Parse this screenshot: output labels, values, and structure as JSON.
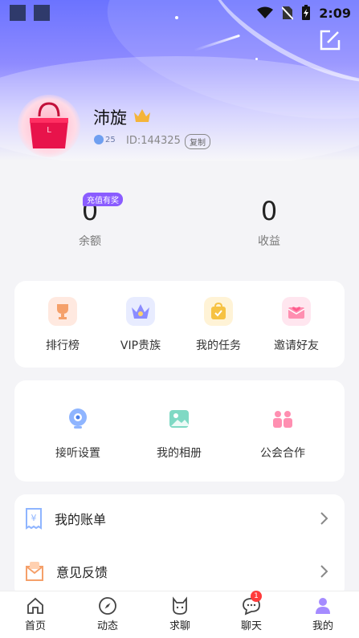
{
  "status_bar": {
    "time": "2:09"
  },
  "profile": {
    "name": "沛旋",
    "level": "25",
    "id_text": "ID:144325",
    "copy_label": "复制"
  },
  "stats": {
    "balance": {
      "value": "0",
      "label": "余额",
      "badge": "充值有奖"
    },
    "income": {
      "value": "0",
      "label": "收益"
    }
  },
  "quick_actions": [
    {
      "label": "排行榜",
      "icon": "trophy-icon"
    },
    {
      "label": "VIP贵族",
      "icon": "crown-icon"
    },
    {
      "label": "我的任务",
      "icon": "task-bag-icon"
    },
    {
      "label": "邀请好友",
      "icon": "invite-mail-icon"
    }
  ],
  "services": [
    {
      "label": "接听设置",
      "icon": "camera-icon"
    },
    {
      "label": "我的相册",
      "icon": "album-icon"
    },
    {
      "label": "公会合作",
      "icon": "guild-icon"
    }
  ],
  "menu_rows": [
    {
      "label": "我的账单",
      "icon": "bill-icon"
    },
    {
      "label": "意见反馈",
      "icon": "feedback-icon"
    }
  ],
  "bottom_nav": [
    {
      "label": "首页",
      "icon": "home-icon"
    },
    {
      "label": "动态",
      "icon": "compass-icon"
    },
    {
      "label": "求聊",
      "icon": "cat-icon"
    },
    {
      "label": "聊天",
      "icon": "chat-icon",
      "badge": "1"
    },
    {
      "label": "我的",
      "icon": "person-icon",
      "active": true
    }
  ],
  "colors": {
    "accent": "#8a5cff",
    "hero": "#6b73ff",
    "badge": "#ff3b3b"
  }
}
